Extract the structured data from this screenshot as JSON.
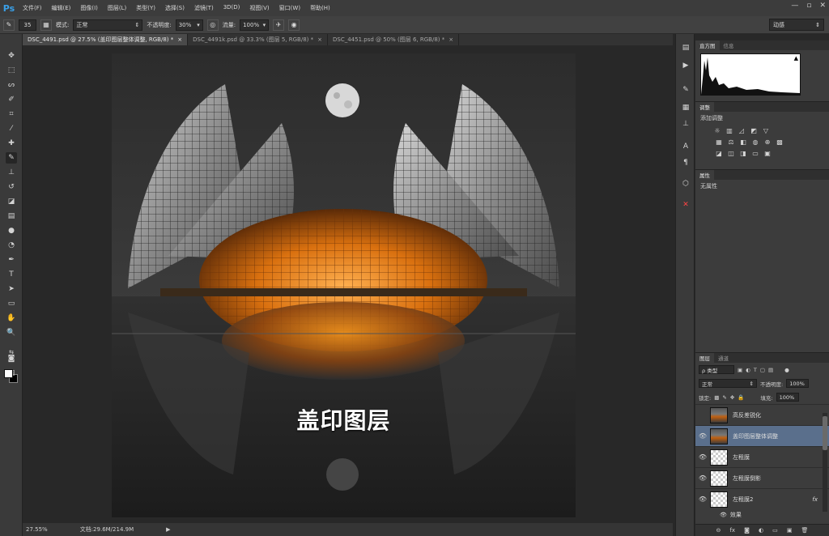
{
  "app": {
    "logo": "Ps"
  },
  "menu": [
    "文件(F)",
    "编辑(E)",
    "图像(I)",
    "图层(L)",
    "类型(Y)",
    "选择(S)",
    "滤镜(T)",
    "3D(D)",
    "视图(V)",
    "窗口(W)",
    "帮助(H)"
  ],
  "window_controls": {
    "minimize": "—",
    "restore": "▫",
    "close": "✕"
  },
  "options": {
    "brush_size": "35",
    "mode_label": "模式:",
    "mode_value": "正常",
    "opacity_label": "不透明度:",
    "opacity_value": "30%",
    "flow_label": "流量:",
    "flow_value": "100%",
    "workspace": "动感"
  },
  "tabs": [
    {
      "label": "DSC_4491.psd @ 27.5% (盖印图层整体调整, RGB/8) *",
      "close": "×",
      "active": true
    },
    {
      "label": "DSC_4491k.psd @ 33.3% (图层 5, RGB/8) *",
      "close": "×",
      "active": false
    },
    {
      "label": "DSC_4451.psd @ 50% (图层 6, RGB/8) *",
      "close": "×",
      "active": false
    }
  ],
  "canvas": {
    "overlay_text": "盖印图层"
  },
  "status": {
    "zoom": "27.55%",
    "doc_info": "文档:29.6M/214.9M",
    "arrow": "▶"
  },
  "panels": {
    "histogram": {
      "tabs": [
        "直方图",
        "信息"
      ],
      "warning": "▲"
    },
    "adjustments": {
      "tabs": [
        "调整"
      ],
      "title": "添加调整"
    },
    "properties": {
      "tabs": [
        "属性"
      ],
      "text": "无属性"
    },
    "layers": {
      "tabs": [
        "图层",
        "通道"
      ],
      "filter_label": "ρ 类型",
      "blend_mode": "正常",
      "opacity_label": "不透明度:",
      "opacity_value": "100%",
      "lock_label": "锁定:",
      "fill_label": "填充:",
      "fill_value": "100%",
      "items": [
        {
          "name": "高反差锐化",
          "visible": false,
          "thumb": "photo",
          "selected": false,
          "fx": ""
        },
        {
          "name": "盖印图层整体调整",
          "visible": true,
          "thumb": "photo",
          "selected": true,
          "fx": ""
        },
        {
          "name": "左租膜",
          "visible": true,
          "thumb": "checker",
          "selected": false,
          "fx": ""
        },
        {
          "name": "左租膜倒影",
          "visible": true,
          "thumb": "checker",
          "selected": false,
          "fx": ""
        },
        {
          "name": "左租膜2",
          "visible": true,
          "thumb": "checker",
          "selected": false,
          "fx": "fx"
        }
      ],
      "effects_label": "效果",
      "footer_icons": [
        "⊖",
        "fx",
        "◙",
        "◐",
        "▭",
        "▣",
        "🗑"
      ]
    }
  }
}
